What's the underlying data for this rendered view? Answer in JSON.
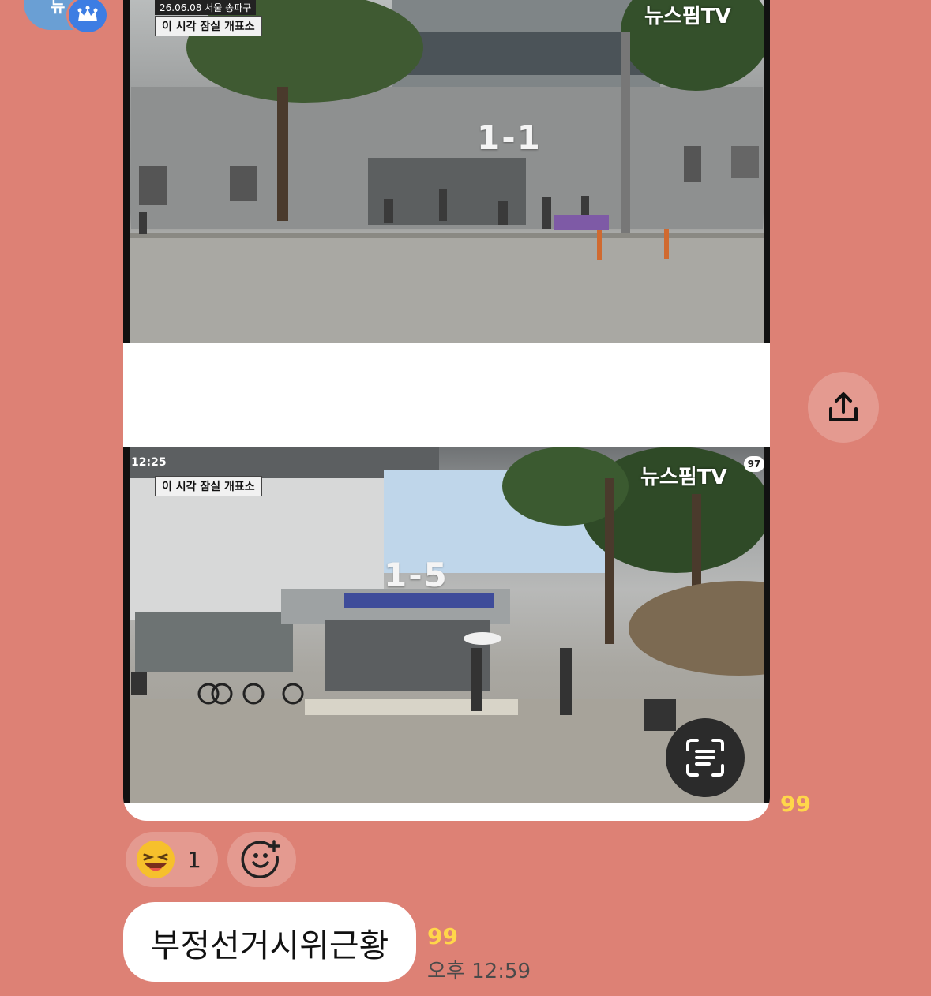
{
  "sender": {
    "avatar_text": "뉴",
    "crown_icon": "crown-icon"
  },
  "image_message": {
    "photo_top": {
      "date_caption": "26.06.08 서울 송파구",
      "title_caption": "이 시각 잠실 개표소",
      "brand": "뉴스핌TV",
      "sign": "1-1"
    },
    "photo_bottom": {
      "time_overlay": "12:25",
      "title_caption": "이 시각 잠실 개표소",
      "brand": "뉴스핌TV",
      "badge": "97",
      "sign": "1-5"
    },
    "unread_count": "99"
  },
  "reactions": {
    "laugh_count": "1"
  },
  "text_message": {
    "text": "부정선거시위근황",
    "unread_count": "99",
    "time": "오후 12:59"
  },
  "colors": {
    "background": "#dd8175",
    "unread": "#ffd64a",
    "bubble": "#ffffff"
  }
}
